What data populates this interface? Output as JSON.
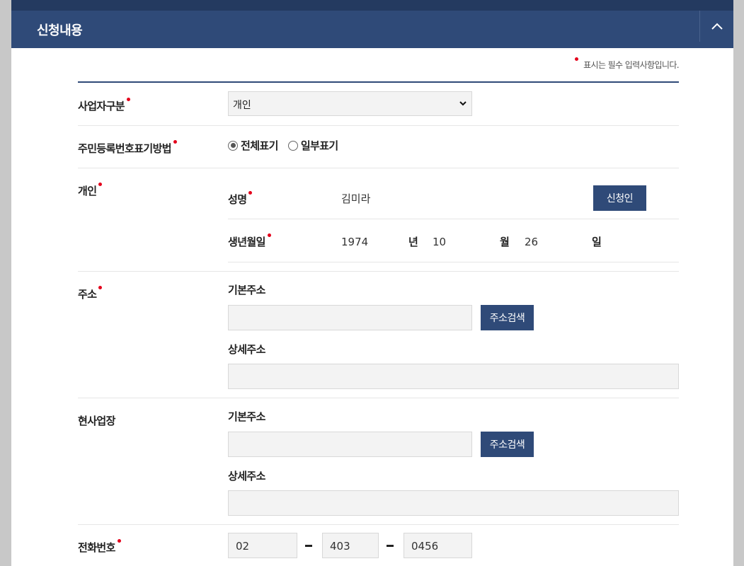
{
  "header": {
    "title": "신청내용",
    "collapse_icon": "chevron-up-icon"
  },
  "required_note": "표시는 필수 입력사항입니다.",
  "colors": {
    "header_bg": "#2f4a78",
    "required_dot": "#e4001b",
    "button_bg": "#2f4a78"
  },
  "business_type": {
    "label": "사업자구분",
    "selected": "개인"
  },
  "rrn_display": {
    "label": "주민등록번호표기방법",
    "options": [
      "전체표기",
      "일부표기"
    ],
    "selected": "전체표기"
  },
  "individual": {
    "label": "개인",
    "name_label": "성명",
    "name_value": "김미라",
    "applicant_button": "신청인",
    "birth_label": "생년월일",
    "birth_year": "1974",
    "year_unit": "년",
    "birth_month": "10",
    "month_unit": "월",
    "birth_day": "26",
    "day_unit": "일"
  },
  "address": {
    "label": "주소",
    "basic_label": "기본주소",
    "basic_value": "",
    "search_button": "주소검색",
    "detail_label": "상세주소",
    "detail_value": ""
  },
  "business_site": {
    "label": "현사업장",
    "basic_label": "기본주소",
    "basic_value": "",
    "search_button": "주소검색",
    "detail_label": "상세주소",
    "detail_value": ""
  },
  "phone": {
    "label": "전화번호",
    "part1": "02",
    "part2": "403",
    "part3": "0456"
  }
}
